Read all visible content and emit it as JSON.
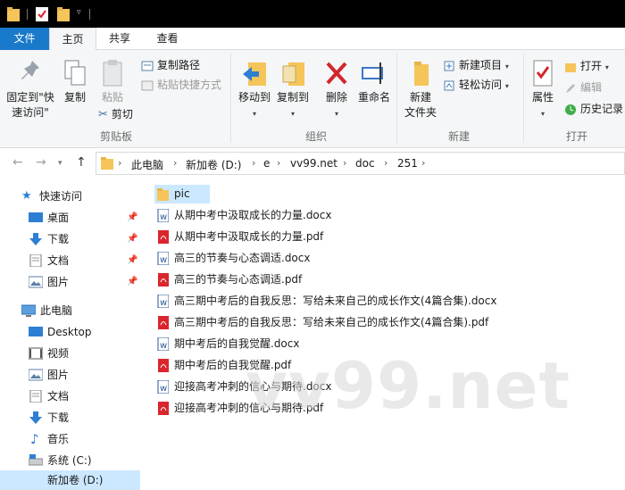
{
  "ribbon_tabs": {
    "file": "文件",
    "home": "主页",
    "share": "共享",
    "view": "查看"
  },
  "clipboard": {
    "pin_label_1": "固定到\"快",
    "pin_label_2": "速访问\"",
    "copy": "复制",
    "paste": "粘贴",
    "copy_path": "复制路径",
    "paste_shortcut": "粘贴快捷方式",
    "cut": "剪切",
    "group": "剪贴板"
  },
  "organize": {
    "move_to": "移动到",
    "copy_to": "复制到",
    "delete": "删除",
    "rename": "重命名",
    "group": "组织"
  },
  "new_group": {
    "new_folder_1": "新建",
    "new_folder_2": "文件夹",
    "new_item": "新建项目",
    "easy_access": "轻松访问",
    "group": "新建"
  },
  "open_group": {
    "properties": "属性",
    "open": "打开",
    "edit": "编辑",
    "history": "历史记录",
    "group": "打开"
  },
  "breadcrumbs": [
    "此电脑",
    "新加卷 (D:)",
    "e",
    "vv99.net",
    "doc",
    "251"
  ],
  "nav": {
    "quick_access": "快速访问",
    "desktop": "桌面",
    "downloads": "下载",
    "documents": "文档",
    "pictures": "图片",
    "this_pc": "此电脑",
    "pc_desktop": "Desktop",
    "videos": "视频",
    "pc_pictures": "图片",
    "pc_documents": "文档",
    "pc_downloads": "下载",
    "music": "音乐",
    "system_c": "系统 (C:)",
    "new_volume_d": "新加卷 (D:)"
  },
  "files": [
    {
      "name": "pic",
      "type": "folder"
    },
    {
      "name": "从期中考中汲取成长的力量.docx",
      "type": "docx"
    },
    {
      "name": "从期中考中汲取成长的力量.pdf",
      "type": "pdf"
    },
    {
      "name": "高三的节奏与心态调适.docx",
      "type": "docx"
    },
    {
      "name": "高三的节奏与心态调适.pdf",
      "type": "pdf"
    },
    {
      "name": "高三期中考后的自我反思：写给未来自己的成长作文(4篇合集).docx",
      "type": "docx"
    },
    {
      "name": "高三期中考后的自我反思：写给未来自己的成长作文(4篇合集).pdf",
      "type": "pdf"
    },
    {
      "name": "期中考后的自我觉醒.docx",
      "type": "docx"
    },
    {
      "name": "期中考后的自我觉醒.pdf",
      "type": "pdf"
    },
    {
      "name": "迎接高考冲刺的信心与期待.docx",
      "type": "docx"
    },
    {
      "name": "迎接高考冲刺的信心与期待.pdf",
      "type": "pdf"
    }
  ],
  "watermark": "vv99.net",
  "colors": {
    "accent": "#1979ca",
    "selection": "#cce8ff",
    "folder": "#f5c55a",
    "pdf": "#d9262c",
    "doc": "#2b5797"
  }
}
